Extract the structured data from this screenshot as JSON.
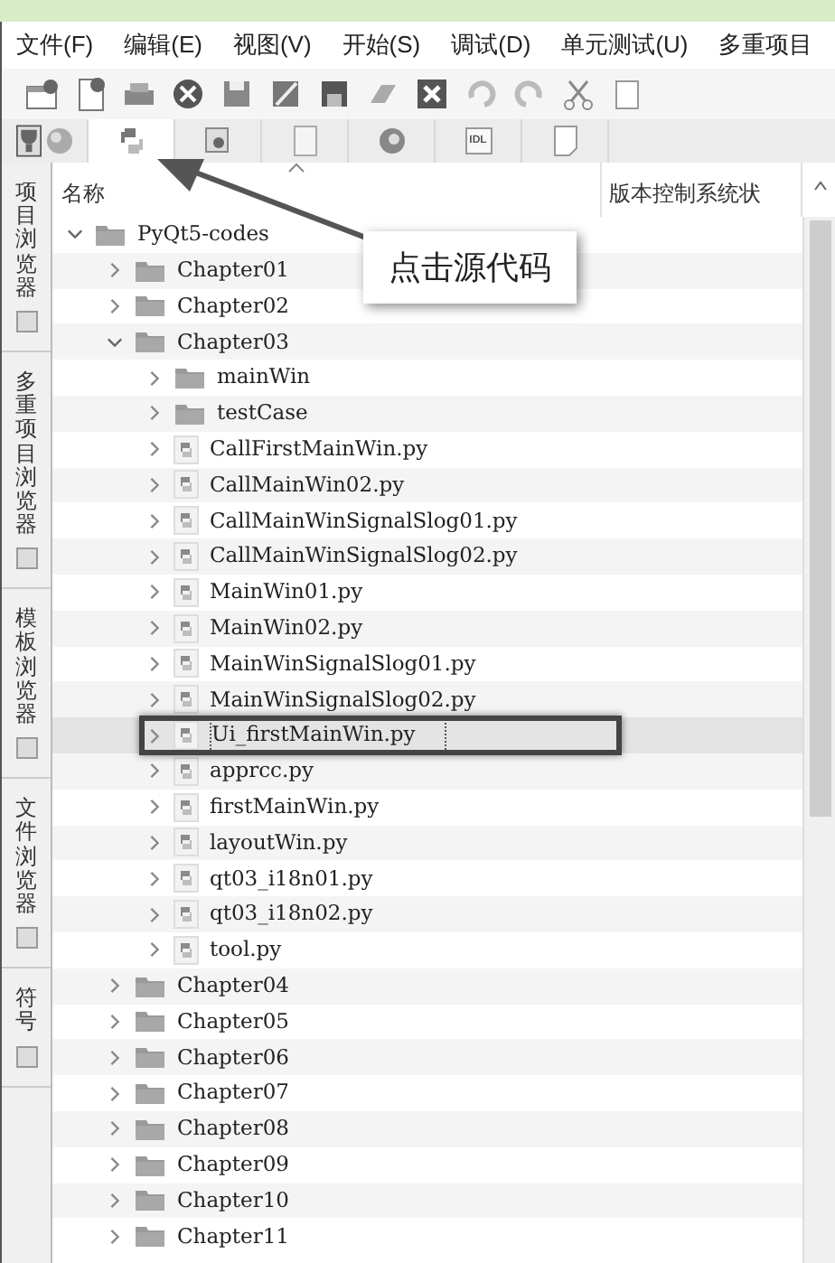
{
  "menu": [
    "文件(F)",
    "编辑(E)",
    "视图(V)",
    "开始(S)",
    "调试(D)",
    "单元测试(U)",
    "多重项目"
  ],
  "tabs": [
    {
      "selected": false
    },
    {
      "selected": true
    },
    {
      "selected": false
    },
    {
      "selected": false
    },
    {
      "selected": false
    },
    {
      "label": "IDL",
      "selected": false
    },
    {
      "selected": false
    }
  ],
  "side_tabs": [
    "项目浏览器",
    "多重项目浏览器",
    "模板浏览器",
    "文件浏览器",
    "符号"
  ],
  "columns": [
    "名称",
    "版本控制系统状"
  ],
  "tree": [
    {
      "name": "PyQt5-codes",
      "kind": "folder",
      "expanded": true,
      "selected": false,
      "children": [
        {
          "name": "Chapter01",
          "kind": "folder",
          "expanded": false,
          "selected": false
        },
        {
          "name": "Chapter02",
          "kind": "folder",
          "expanded": false,
          "selected": false
        },
        {
          "name": "Chapter03",
          "kind": "folder",
          "expanded": true,
          "selected": false,
          "children": [
            {
              "name": "mainWin",
              "kind": "folder",
              "expanded": false,
              "selected": false
            },
            {
              "name": "testCase",
              "kind": "folder",
              "expanded": false,
              "selected": false
            },
            {
              "name": "CallFirstMainWin.py",
              "kind": "file",
              "expanded": false,
              "selected": false
            },
            {
              "name": "CallMainWin02.py",
              "kind": "file",
              "expanded": false,
              "selected": false
            },
            {
              "name": "CallMainWinSignalSlog01.py",
              "kind": "file",
              "expanded": false,
              "selected": false
            },
            {
              "name": "CallMainWinSignalSlog02.py",
              "kind": "file",
              "expanded": false,
              "selected": false
            },
            {
              "name": "MainWin01.py",
              "kind": "file",
              "expanded": false,
              "selected": false
            },
            {
              "name": "MainWin02.py",
              "kind": "file",
              "expanded": false,
              "selected": false
            },
            {
              "name": "MainWinSignalSlog01.py",
              "kind": "file",
              "expanded": false,
              "selected": false
            },
            {
              "name": "MainWinSignalSlog02.py",
              "kind": "file",
              "expanded": false,
              "selected": false
            },
            {
              "name": "Ui_firstMainWin.py",
              "kind": "file",
              "expanded": false,
              "selected": true
            },
            {
              "name": "apprcc.py",
              "kind": "file",
              "expanded": false,
              "selected": false
            },
            {
              "name": "firstMainWin.py",
              "kind": "file",
              "expanded": false,
              "selected": false
            },
            {
              "name": "layoutWin.py",
              "kind": "file",
              "expanded": false,
              "selected": false
            },
            {
              "name": "qt03_i18n01.py",
              "kind": "file",
              "expanded": false,
              "selected": false
            },
            {
              "name": "qt03_i18n02.py",
              "kind": "file",
              "expanded": false,
              "selected": false
            },
            {
              "name": "tool.py",
              "kind": "file",
              "expanded": false,
              "selected": false
            }
          ]
        },
        {
          "name": "Chapter04",
          "kind": "folder",
          "expanded": false,
          "selected": false
        },
        {
          "name": "Chapter05",
          "kind": "folder",
          "expanded": false,
          "selected": false
        },
        {
          "name": "Chapter06",
          "kind": "folder",
          "expanded": false,
          "selected": false
        },
        {
          "name": "Chapter07",
          "kind": "folder",
          "expanded": false,
          "selected": false
        },
        {
          "name": "Chapter08",
          "kind": "folder",
          "expanded": false,
          "selected": false
        },
        {
          "name": "Chapter09",
          "kind": "folder",
          "expanded": false,
          "selected": false
        },
        {
          "name": "Chapter10",
          "kind": "folder",
          "expanded": false,
          "selected": false
        },
        {
          "name": "Chapter11",
          "kind": "folder",
          "expanded": false,
          "selected": false
        }
      ]
    }
  ],
  "callout": "点击源代码"
}
